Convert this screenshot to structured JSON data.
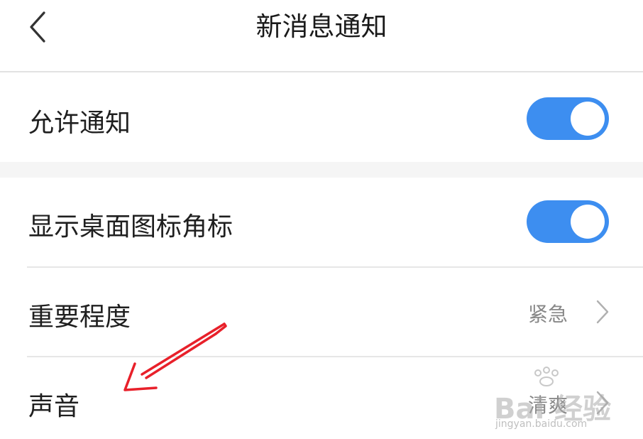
{
  "header": {
    "title": "新消息通知",
    "back_icon": "chevron-left-icon"
  },
  "settings": {
    "allow_notifications": {
      "label": "允许通知",
      "toggle_on": true
    },
    "badge_icon": {
      "label": "显示桌面图标角标",
      "toggle_on": true
    },
    "importance": {
      "label": "重要程度",
      "value": "紧急"
    },
    "sound": {
      "label": "声音",
      "value": "清爽"
    }
  },
  "colors": {
    "toggle_on": "#3d8ef0",
    "annotation_arrow": "#e8202a",
    "section_gap": "#f5f5f5"
  },
  "watermark": {
    "logo": "Bai 经验",
    "url": "jingyan.baidu.com"
  }
}
